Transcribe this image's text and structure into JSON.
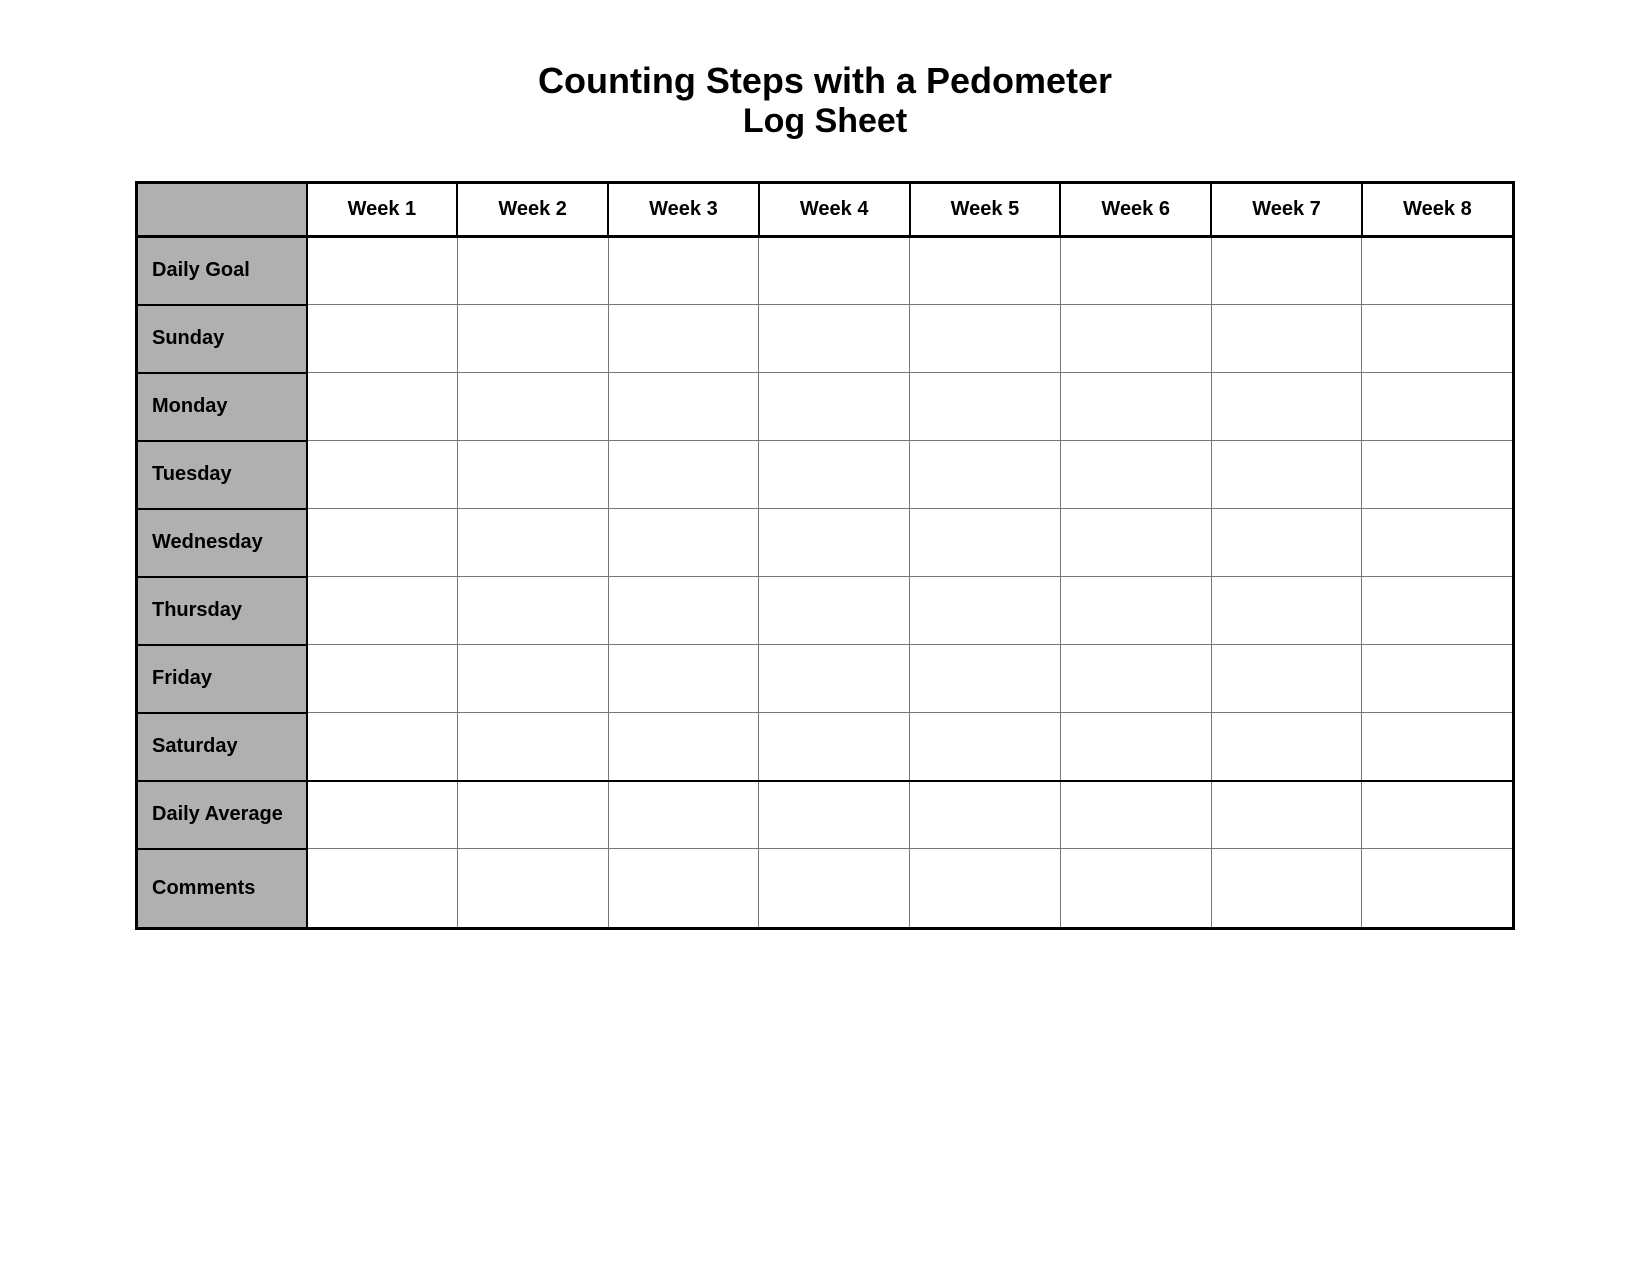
{
  "title": {
    "line1": "Counting Steps with a Pedometer",
    "line2": "Log Sheet"
  },
  "table": {
    "header": {
      "row_label": "",
      "weeks": [
        "Week 1",
        "Week 2",
        "Week 3",
        "Week 4",
        "Week 5",
        "Week 6",
        "Week 7",
        "Week 8"
      ]
    },
    "rows": [
      {
        "label": "Daily Goal"
      },
      {
        "label": "Sunday"
      },
      {
        "label": "Monday"
      },
      {
        "label": "Tuesday"
      },
      {
        "label": "Wednesday"
      },
      {
        "label": "Thursday"
      },
      {
        "label": "Friday"
      },
      {
        "label": "Saturday"
      },
      {
        "label": "Daily Average"
      },
      {
        "label": "Comments"
      }
    ]
  }
}
